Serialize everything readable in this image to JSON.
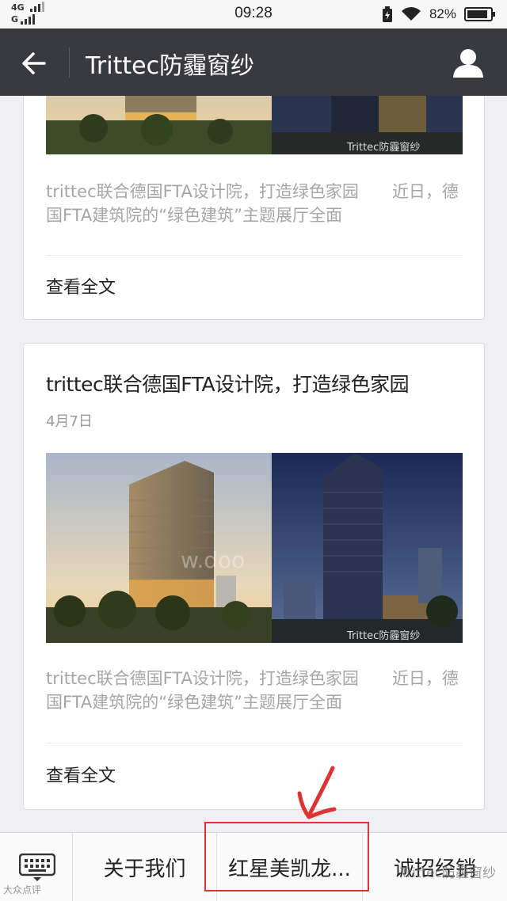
{
  "status_bar": {
    "network_top": "4G",
    "network_bottom": "G",
    "time": "09:28",
    "battery_percent": "82%",
    "icons": [
      "signal-icon",
      "charging-icon",
      "wifi-icon",
      "battery-icon"
    ]
  },
  "nav": {
    "title": "Trittec防霾窗纱",
    "back_icon": "back-arrow-icon",
    "profile_icon": "user-icon"
  },
  "articles": [
    {
      "title": "",
      "date": "",
      "description": "trittec联合德国FTA设计院，打造绿色家园　　近日，德国FTA建筑院的“绿色建筑”主题展厅全面",
      "read_more": "查看全文",
      "image_caption": "Trittec防霾窗纱"
    },
    {
      "title": "trittec联合德国FTA设计院，打造绿色家园",
      "date": "4月7日",
      "description": "trittec联合德国FTA设计院，打造绿色家园　　近日，德国FTA建筑院的“绿色建筑”主题展厅全面",
      "read_more": "查看全文",
      "image_caption": "Trittec防霾窗纱"
    }
  ],
  "bottom_menu": {
    "keyboard_icon": "keyboard-icon",
    "items": [
      "关于我们",
      "红星美凯龙...",
      "诚招经销"
    ]
  },
  "annotation": {
    "highlight_color": "#d33333"
  },
  "watermark": "Trittec防霾窗纱",
  "watermark_left": "大众点评",
  "colors": {
    "navbar_bg": "#393a3f",
    "page_bg": "#efeff4",
    "card_bg": "#ffffff",
    "muted_text": "#a6a6a6"
  }
}
